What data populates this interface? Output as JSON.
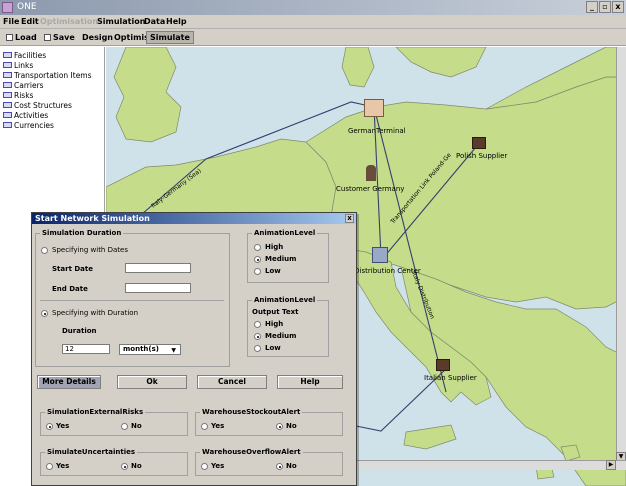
{
  "window": {
    "title": "ONE",
    "buttons": [
      "_",
      "▫",
      "x"
    ]
  },
  "menu": [
    {
      "label": "File",
      "disabled": false
    },
    {
      "label": "Edit",
      "disabled": false
    },
    {
      "label": "Optimisation",
      "disabled": true
    },
    {
      "label": "Simulation",
      "disabled": false
    },
    {
      "label": "Data",
      "disabled": false
    },
    {
      "label": "Help",
      "disabled": false
    }
  ],
  "toolbar": {
    "load": "Load",
    "save": "Save",
    "design": "Design",
    "optimise": "Optimise",
    "simulate": "Simulate"
  },
  "tree": [
    "Facilities",
    "Links",
    "Transportation Items",
    "Carriers",
    "Risks",
    "Cost Structures",
    "Activities",
    "Currencies"
  ],
  "map": {
    "colors": {
      "sea": "#cfe2ea",
      "land": "#c5dd8a",
      "border": "#7e8a6a",
      "route": "#33406e"
    },
    "facilities": [
      "GermanTerminal",
      "Polish Supplier",
      "Customer Germany",
      "l Distribution Center",
      "Italian Supplier"
    ],
    "route_labels": [
      "Italy-Germany (Sea)",
      "Transportation Link Poland-Ge",
      "Italy-Distribution"
    ]
  },
  "dialog": {
    "title": "Start Network Simulation",
    "close": "x",
    "duration": {
      "title": "Simulation Duration",
      "with_dates": "Specifying with Dates",
      "start_date": "Start Date",
      "end_date": "End Date",
      "with_duration": "Specifying with Duration",
      "duration": "Duration",
      "duration_value": "12",
      "unit": "month(s)"
    },
    "animation": {
      "title": "AnimationLevel",
      "high": "High",
      "medium": "Medium",
      "low": "Low"
    },
    "output": {
      "title": "AnimationLevel",
      "subtitle": "Output Text",
      "high": "High",
      "medium": "Medium",
      "low": "Low"
    },
    "buttons": {
      "more": "More Details",
      "ok": "Ok",
      "cancel": "Cancel",
      "help": "Help"
    },
    "ext_risks": {
      "title": "SimulationExternalRisks",
      "yes": "Yes",
      "no": "No"
    },
    "stockout": {
      "title": "WarehouseStockoutAlert",
      "yes": "Yes",
      "no": "No"
    },
    "uncert": {
      "title": "SimulateUncertainties",
      "yes": "Yes",
      "no": "No"
    },
    "overflow": {
      "title": "WarehouseOverflowAlert",
      "yes": "Yes",
      "no": "No"
    }
  }
}
